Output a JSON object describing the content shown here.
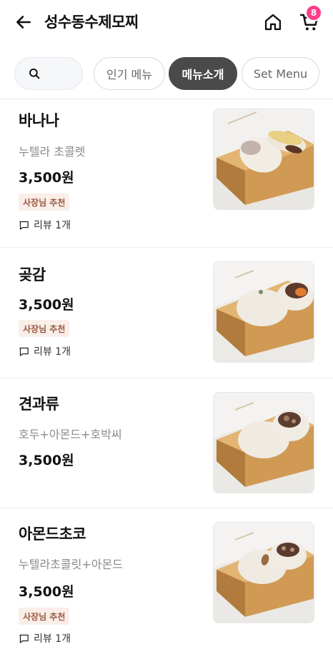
{
  "header": {
    "title": "성수동수제모찌",
    "back_icon": "arrow-left-icon",
    "home_icon": "home-icon",
    "cart_icon": "cart-icon",
    "cart_count": "8",
    "badge_color": "#ff3d8b"
  },
  "tabs": {
    "search_icon": "search-icon",
    "items": [
      {
        "label": "인기 메뉴",
        "active": false
      },
      {
        "label": "메뉴소개",
        "active": true
      },
      {
        "label": "Set Menu",
        "active": false
      }
    ]
  },
  "menu": {
    "items": [
      {
        "name": "바나나",
        "desc": "누텔라 초콜렛",
        "price": "3,500원",
        "badge": "사장님 추천",
        "review": "리뷰 1개",
        "image": "banana-mochi-photo"
      },
      {
        "name": "곶감",
        "desc": "",
        "price": "3,500원",
        "badge": "사장님 추천",
        "review": "리뷰 1개",
        "image": "persimmon-mochi-photo"
      },
      {
        "name": "견과류",
        "desc": "호두+아몬드+호박씨",
        "price": "3,500원",
        "badge": "",
        "review": "",
        "image": "nut-mochi-photo"
      },
      {
        "name": "아몬드초코",
        "desc": "누텔라초콜릿+아몬드",
        "price": "3,500원",
        "badge": "사장님 추천",
        "review": "리뷰 1개",
        "image": "almond-choco-mochi-photo"
      }
    ]
  }
}
